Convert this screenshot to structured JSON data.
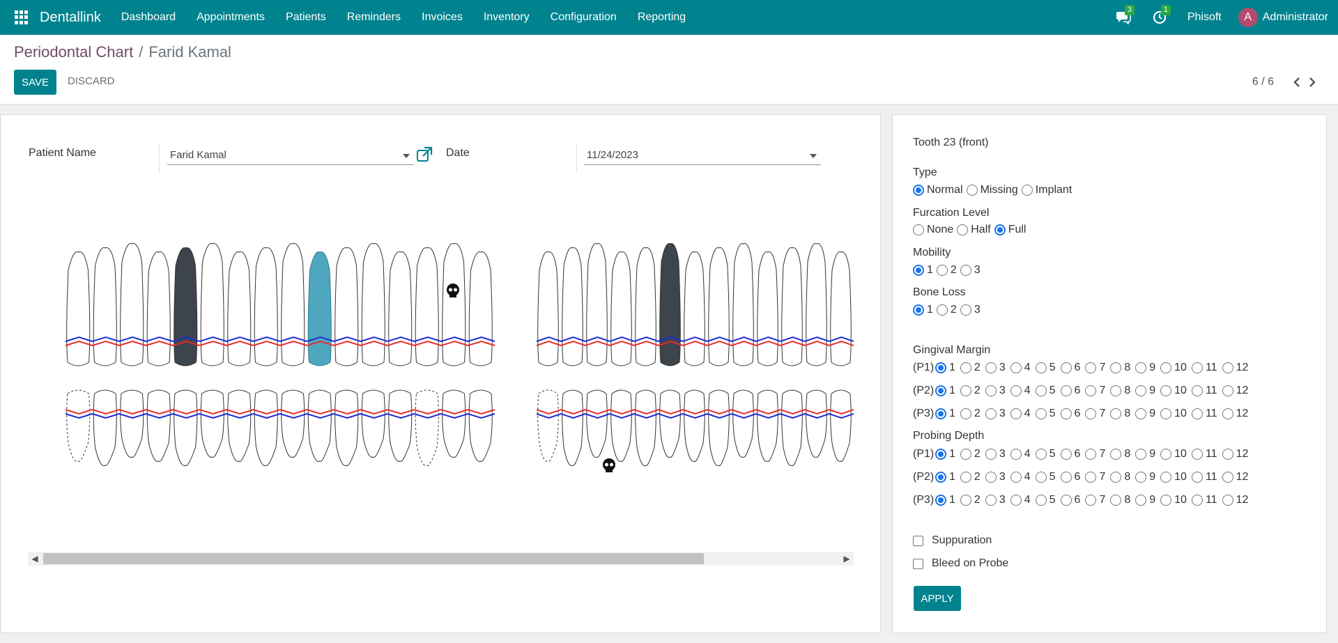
{
  "navbar": {
    "brand": "Dentallink",
    "menu": [
      "Dashboard",
      "Appointments",
      "Patients",
      "Reminders",
      "Invoices",
      "Inventory",
      "Configuration",
      "Reporting"
    ],
    "messages_count": "3",
    "activities_count": "1",
    "company": "Phisoft",
    "user_initial": "A",
    "user_name": "Administrator"
  },
  "control_panel": {
    "breadcrumb_parent": "Periodontal Chart",
    "breadcrumb_separator": "/",
    "breadcrumb_current": "Farid Kamal",
    "save_label": "SAVE",
    "discard_label": "DISCARD",
    "pager": "6 / 6"
  },
  "form": {
    "patient_label": "Patient Name",
    "patient_value": "Farid Kamal",
    "date_label": "Date",
    "date_value": "11/24/2023"
  },
  "tooth_panel": {
    "title": "Tooth 23 (front)",
    "type_label": "Type",
    "type_options": [
      "Normal",
      "Missing",
      "Implant"
    ],
    "type_selected": "Normal",
    "furcation_label": "Furcation Level",
    "furcation_options": [
      "None",
      "Half",
      "Full"
    ],
    "furcation_selected": "Full",
    "mobility_label": "Mobility",
    "mobility_options": [
      "1",
      "2",
      "3"
    ],
    "mobility_selected": "1",
    "bone_loss_label": "Bone Loss",
    "bone_loss_options": [
      "1",
      "2",
      "3"
    ],
    "bone_loss_selected": "1",
    "gingival_label": "Gingival Margin",
    "probing_label": "Probing Depth",
    "point_labels": [
      "(P1)",
      "(P2)",
      "(P3)"
    ],
    "scale": [
      "1",
      "2",
      "3",
      "4",
      "5",
      "6",
      "7",
      "8",
      "9",
      "10",
      "11",
      "12"
    ],
    "gingival_selected": [
      "1",
      "1",
      "1"
    ],
    "probing_selected": [
      "1",
      "1",
      "1"
    ],
    "suppuration_label": "Suppuration",
    "bleed_label": "Bleed on Probe",
    "apply_label": "APPLY"
  },
  "colors": {
    "brand": "#00838f",
    "highlight_tooth": "#4fa7bf",
    "missing_tooth": "#3e444b",
    "gum_line_blue": "#1f2bd6",
    "gum_line_red": "#e62d2d"
  }
}
